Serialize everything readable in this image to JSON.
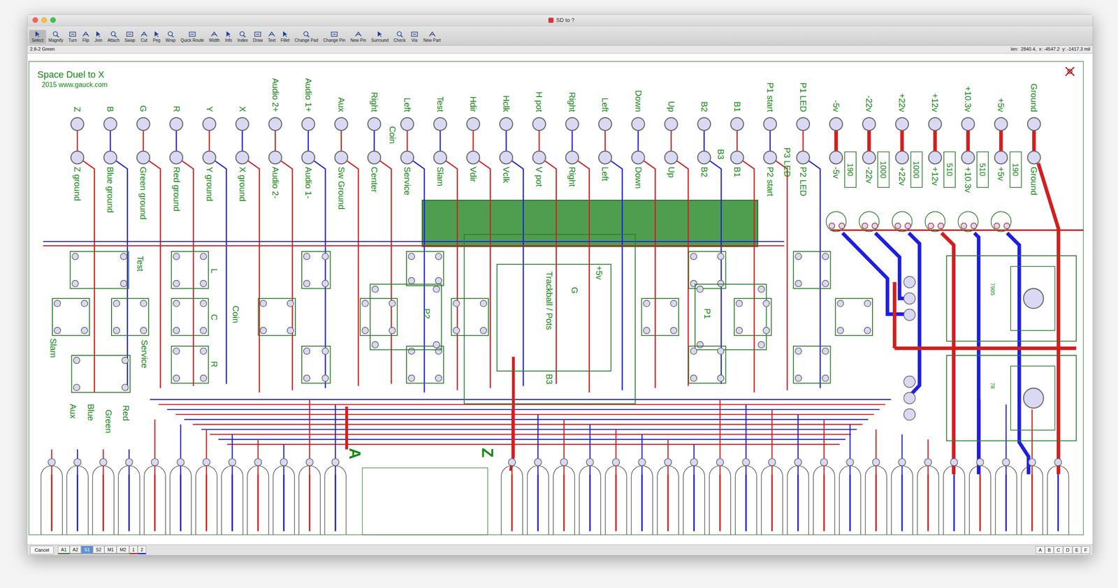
{
  "window": {
    "title": "SD to ?"
  },
  "toolbar": [
    {
      "label": "Select",
      "selected": true
    },
    {
      "label": "Magnify",
      "selected": false
    },
    {
      "label": "Turn",
      "selected": false
    },
    {
      "label": "Flip",
      "selected": false
    },
    {
      "label": "Join",
      "selected": false
    },
    {
      "label": "Attach",
      "selected": false
    },
    {
      "label": "Swap",
      "selected": false
    },
    {
      "label": "Cut",
      "selected": false
    },
    {
      "label": "Peg",
      "selected": false
    },
    {
      "label": "Wrap",
      "selected": false
    },
    {
      "label": "Quick Route",
      "selected": false
    },
    {
      "label": "Width",
      "selected": false
    },
    {
      "label": "Info",
      "selected": false
    },
    {
      "label": "Index",
      "selected": false
    },
    {
      "label": "Draw",
      "selected": false
    },
    {
      "label": "Text",
      "selected": false
    },
    {
      "label": "Fillet",
      "selected": false
    },
    {
      "label": "Change Pad",
      "selected": false
    },
    {
      "label": "Change Pin",
      "selected": false
    },
    {
      "label": "New Pin",
      "selected": false
    },
    {
      "label": "Surround",
      "selected": false
    },
    {
      "label": "Check",
      "selected": false
    },
    {
      "label": "Via",
      "selected": false
    },
    {
      "label": "New Part",
      "selected": false
    }
  ],
  "status": {
    "left": "2.8-2 Green",
    "right": "len:  2840.4,  x: -4547.2  y: -1417.3 mil"
  },
  "board": {
    "title": "Space Duel to X",
    "subtitle": "2015 www.gauck.com",
    "top_pins": [
      "Z",
      "B",
      "G",
      "R",
      "Y",
      "X",
      "Audio 2+",
      "Audio 1+",
      "Aux",
      "Right",
      "Left",
      "Test",
      "Hdir",
      "Hclk",
      "H pot",
      "Right",
      "Left",
      "Down",
      "Up",
      "B2",
      "B1",
      "P1 start",
      "P1 LED",
      "-5v",
      "-22v",
      "+22v",
      "+12v",
      "+10.3v",
      "+5v",
      "Ground"
    ],
    "inner_pins": [
      "Z ground",
      "Blue ground",
      "Green ground",
      "Red ground",
      "Y ground",
      "X ground",
      "Audio 2-",
      "Audio 1-",
      "Sw Ground",
      "Center",
      "Service",
      "Slam",
      "Vdir",
      "Vclk",
      "V pot",
      "Right",
      "Left",
      "Down",
      "Up",
      "B2",
      "B1",
      "P2 start",
      "P2 LED",
      "-5v",
      "-22v",
      "+22v",
      "+12v",
      "+10.3v",
      "+5v",
      "Ground"
    ],
    "resistors": [
      "190",
      "1000",
      "1000",
      "510",
      "510",
      "190"
    ],
    "part_labels": [
      "Coin",
      "B3",
      "P3 LED",
      "Test",
      "Slam",
      "Service",
      "L",
      "C",
      "R",
      "Coin",
      "P2",
      "P1",
      "Trackball / Pots",
      "B3",
      "+5v",
      "G",
      "Aux",
      "Blue",
      "Green",
      "Red",
      "7905",
      "78"
    ],
    "edge_markers": [
      "A",
      "Z"
    ]
  },
  "bottom": {
    "cancel": "Cancel",
    "layers": [
      {
        "label": "A1",
        "selected": false,
        "color": "#2a8a2a"
      },
      {
        "label": "A2",
        "selected": false,
        "color": "#9aa0a6"
      },
      {
        "label": "S1",
        "selected": true,
        "color": "#9aa0a6"
      },
      {
        "label": "S2",
        "selected": false,
        "color": "#9aa0a6"
      },
      {
        "label": "M1",
        "selected": false,
        "color": "#9aa0a6"
      },
      {
        "label": "M2",
        "selected": false,
        "color": "#9aa0a6"
      },
      {
        "label": "1",
        "selected": false,
        "color": "#d42020"
      },
      {
        "label": "2",
        "selected": false,
        "color": "#2020e0"
      }
    ],
    "pages": [
      "A",
      "B",
      "C",
      "D",
      "E",
      "F"
    ]
  }
}
